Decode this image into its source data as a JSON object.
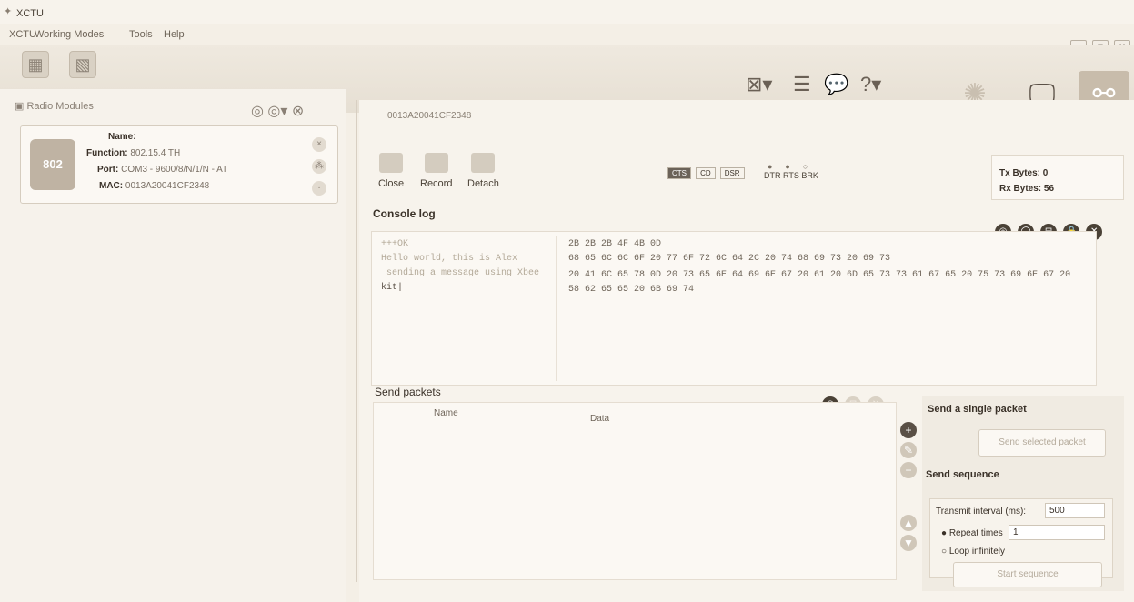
{
  "window": {
    "title": "XCTU"
  },
  "menu": [
    "XCTU",
    "Working Modes",
    "Tools",
    "Help"
  ],
  "radio_panel": {
    "header": "Radio Modules",
    "card": {
      "badge_text": "802",
      "name_label": "Name:",
      "name_value": "",
      "function_label": "Function:",
      "function_value": "802.15.4 TH",
      "port_label": "Port:",
      "port_value": "COM3 - 9600/8/N/1/N - AT",
      "mac_label": "MAC:",
      "mac_value": "0013A20041CF2348"
    }
  },
  "console": {
    "tab_title": "0013A20041CF2348",
    "controls": {
      "close": "Close",
      "record": "Record",
      "detach": "Detach"
    },
    "leds": [
      "CTS",
      "CD",
      "DSR"
    ],
    "lines_label": "DTR RTS BRK",
    "tx_bytes": "Tx Bytes: 0",
    "rx_bytes": "Rx Bytes: 56",
    "log_label": "Console log",
    "ascii_lines": [
      "+++OK",
      "Hello world, this is Alex",
      " sending a message using Xbee",
      "kit|"
    ],
    "hex_lines": [
      "2B 2B 2B 4F 4B 0D",
      "68 65 6C 6C 6F 20 77 6F 72 6C 64 2C 20 74 68 69 73 20 69 73",
      "20 41 6C 65 78 0D 20 73 65 6E 64 69 6E 67 20 61 20 6D 65 73 73 61 67 65 20 75 73 69 6E 67 20 58 62 65 65 20 6B 69 74",
      ""
    ]
  },
  "send_packets": {
    "label": "Send packets",
    "columns": [
      "Name",
      "Data"
    ]
  },
  "single_packet": {
    "title": "Send a single packet",
    "button": "Send selected packet"
  },
  "sequence": {
    "title": "Send sequence",
    "interval_label": "Transmit interval (ms):",
    "interval_value": "500",
    "repeat_label": "Repeat times",
    "repeat_value": "1",
    "loop_label": "Loop infinitely",
    "start_button": "Start sequence"
  }
}
